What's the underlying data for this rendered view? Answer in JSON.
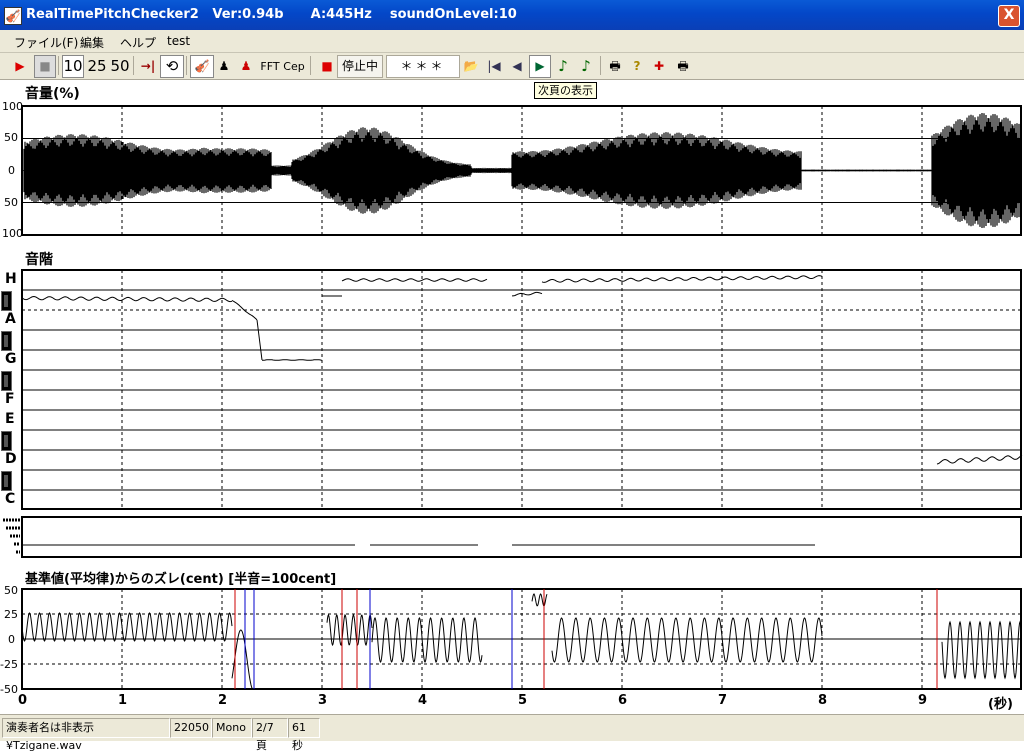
{
  "window": {
    "title": "RealTimePitchChecker2   Ver:0.94b      A:445Hz    soundOnLevel:10",
    "close_label": "X",
    "app_icon": "🎻"
  },
  "menu": [
    {
      "label": "ファイル(F)"
    },
    {
      "label": "編集"
    },
    {
      "label": "ヘルプ"
    },
    {
      "label": "test"
    }
  ],
  "toolbar": {
    "play_icon": "▶",
    "stop_icon": "■",
    "speed_10": "10",
    "speed_25": "25",
    "speed_50": "50",
    "to_end_icon": "→|",
    "loop_icon": "⟲",
    "violin_icon": "🎻",
    "player_icon": "♟",
    "player2_icon": "♟",
    "fft_label": "FFT",
    "cep_label": "Cep",
    "rec_icon": "■",
    "status_text": "停止中",
    "note_display": "＊＊＊",
    "open_icon": "📂",
    "first_page_icon": "|◀",
    "prev_page_icon": "◀",
    "next_page_icon": "▶",
    "note_icon_1": "♪",
    "note_icon_2": "♪",
    "print_icon": "🖶",
    "help_icon": "?",
    "tool_icon": "✚",
    "print2_icon": "🖶",
    "tooltip": "次頁の表示"
  },
  "panels": {
    "volume": {
      "label": "音量(%)",
      "y_ticks": [
        "100",
        "50",
        "0",
        "50",
        "100"
      ]
    },
    "pitch": {
      "label": "音階",
      "notes": [
        "H",
        "A",
        "G",
        "F",
        "E",
        "D",
        "C"
      ]
    },
    "cent": {
      "label": "基準値(平均律)からのズレ(cent) [半音=100cent]",
      "y_ticks": [
        "50",
        "25",
        "0",
        "-25",
        "-50"
      ]
    }
  },
  "x_axis": {
    "ticks": [
      "0",
      "1",
      "2",
      "3",
      "4",
      "5",
      "6",
      "7",
      "8",
      "9"
    ],
    "unit": "(秒)"
  },
  "statusbar": {
    "file": "演奏者名は非表示¥Tzigane.wav",
    "rate": "22050",
    "channels": "Mono",
    "page": "2/7頁",
    "duration": "61秒"
  },
  "colors": {
    "titlebar": "#0347c8",
    "chrome": "#ece9d8",
    "trace": "#000000",
    "marker_red": "#cc0000",
    "marker_blue": "#0000cc"
  }
}
